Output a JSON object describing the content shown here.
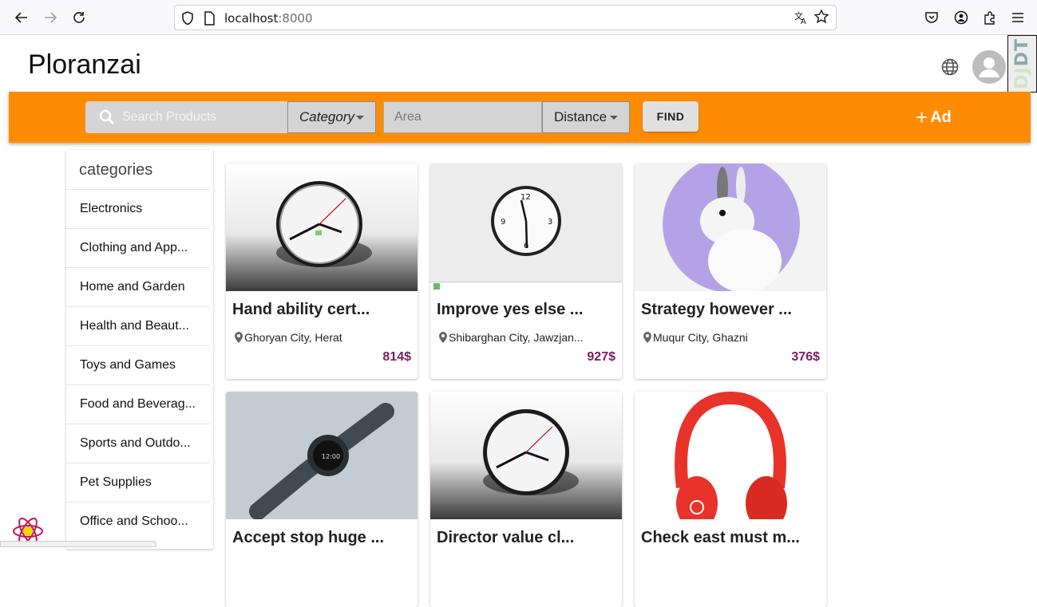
{
  "browser": {
    "url_host": "localhost",
    "url_port": ":8000"
  },
  "header": {
    "brand": "Ploranzai"
  },
  "toolbar_debug": {
    "label_a": "DJ",
    "label_b": "DT"
  },
  "search": {
    "placeholder": "Search Products",
    "category_label": "Category",
    "area_placeholder": "Area",
    "distance_label": "Distance",
    "find_label": "FIND",
    "ad_label": "Ad"
  },
  "sidebar": {
    "heading": "categories",
    "items": [
      "Electronics",
      "Clothing and App...",
      "Home and Garden",
      "Health and Beaut...",
      "Toys and Games",
      "Food and Beverag...",
      "Sports and Outdo...",
      "Pet Supplies",
      "Office and Schoo..."
    ]
  },
  "products": [
    {
      "title": "Hand ability cert...",
      "location": "Ghoryan City, Herat",
      "price": "814$"
    },
    {
      "title": "Improve yes else ...",
      "location": "Shibarghan City, Jawzjan...",
      "price": "927$"
    },
    {
      "title": "Strategy however ...",
      "location": "Muqur City, Ghazni",
      "price": "376$"
    },
    {
      "title": "Accept stop huge ...",
      "location": "",
      "price": ""
    },
    {
      "title": "Director value cl...",
      "location": "",
      "price": ""
    },
    {
      "title": "Check east must m...",
      "location": "",
      "price": ""
    }
  ],
  "colors": {
    "accent": "#ff8c00",
    "price": "#7b1c5c"
  }
}
